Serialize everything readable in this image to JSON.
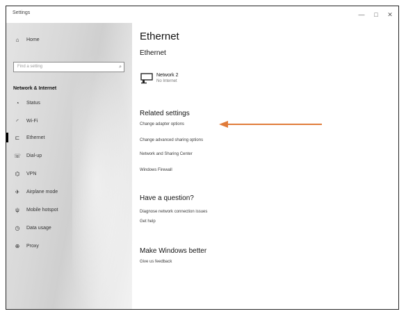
{
  "window": {
    "title": "Settings",
    "controls": {
      "minimize": "—",
      "maximize": "□",
      "close": "✕"
    }
  },
  "sidebar": {
    "home_label": "Home",
    "search_placeholder": "Find a setting",
    "section_title": "Network & Internet",
    "items": [
      {
        "label": "Status",
        "icon": "status-icon"
      },
      {
        "label": "Wi-Fi",
        "icon": "wifi-icon"
      },
      {
        "label": "Ethernet",
        "icon": "ethernet-icon",
        "active": true
      },
      {
        "label": "Dial-up",
        "icon": "dialup-icon"
      },
      {
        "label": "VPN",
        "icon": "vpn-icon"
      },
      {
        "label": "Airplane mode",
        "icon": "airplane-icon"
      },
      {
        "label": "Mobile hotspot",
        "icon": "hotspot-icon"
      },
      {
        "label": "Data usage",
        "icon": "data-usage-icon"
      },
      {
        "label": "Proxy",
        "icon": "globe-icon"
      }
    ]
  },
  "main": {
    "page_title": "Ethernet",
    "subtitle": "Ethernet",
    "network": {
      "name": "Network 2",
      "status": "No Internet"
    },
    "related": {
      "title": "Related settings",
      "links": [
        "Change adapter options",
        "Change advanced sharing options",
        "Network and Sharing Center",
        "Windows Firewall"
      ]
    },
    "question": {
      "title": "Have a question?",
      "links": [
        "Diagnose network connection issues",
        "Get help"
      ]
    },
    "better": {
      "title": "Make Windows better",
      "links": [
        "Give us feedback"
      ]
    }
  },
  "annotation": {
    "arrow_color": "#e07b39"
  }
}
